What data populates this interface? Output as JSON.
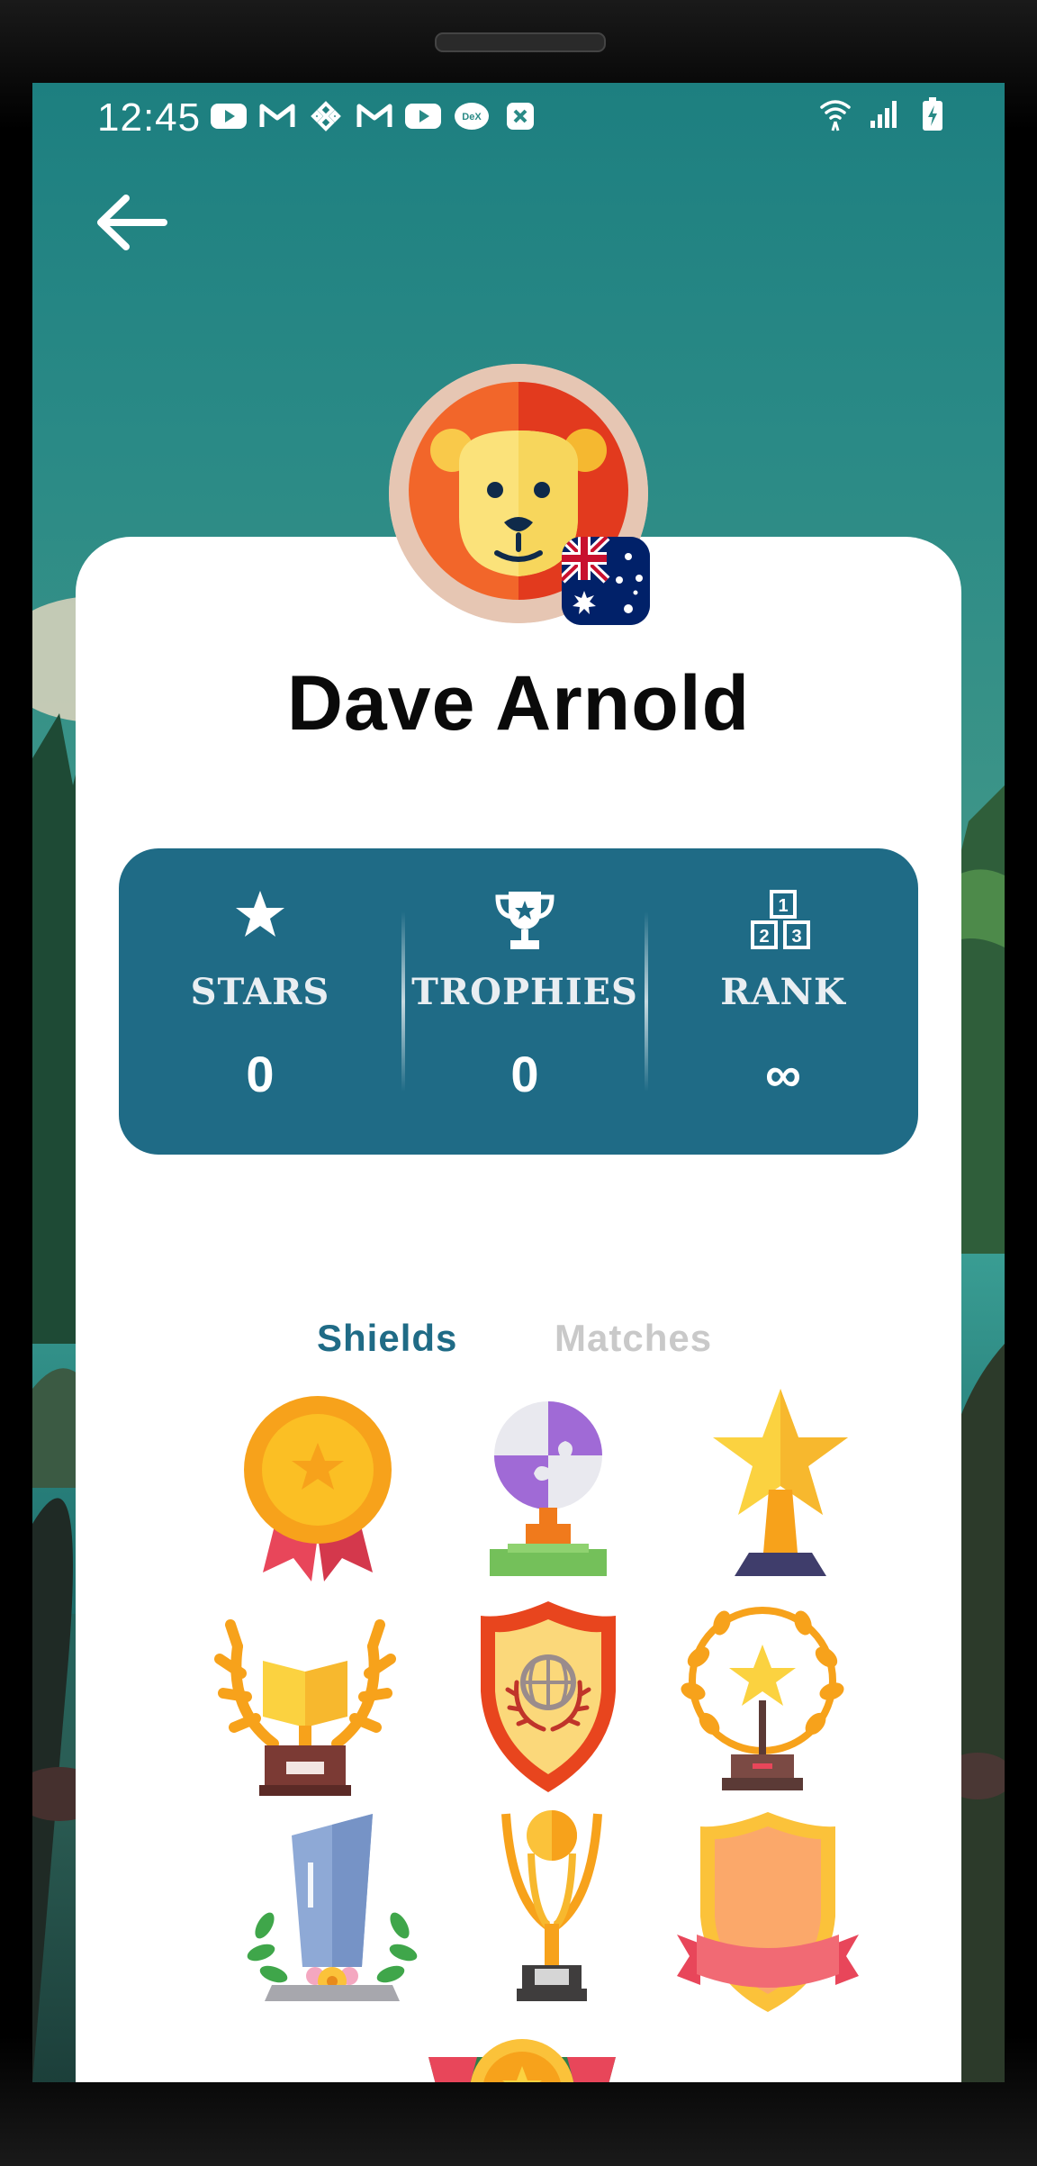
{
  "status_bar": {
    "time": "12:45",
    "notification_icons": [
      "youtube-icon",
      "gmail-icon",
      "binance-icon",
      "gmail-icon",
      "youtube-icon",
      "dex-icon",
      "close-box-icon"
    ],
    "system_icons": [
      "wifi-icon",
      "signal-icon",
      "battery-charging-icon"
    ]
  },
  "profile": {
    "name": "Dave Arnold",
    "avatar": "lion-avatar",
    "country_flag": "australia-flag"
  },
  "stats": [
    {
      "label": "STARS",
      "value": "0",
      "icon": "star-icon"
    },
    {
      "label": "TROPHIES",
      "value": "0",
      "icon": "trophy-icon"
    },
    {
      "label": "RANK",
      "value": "∞",
      "icon": "rank-blocks-icon"
    }
  ],
  "stats_icon_texts": {
    "rank_1": "1",
    "rank_2": "2",
    "rank_3": "3"
  },
  "tabs": {
    "shields": "Shields",
    "matches": "Matches",
    "active": "Shields"
  },
  "shields": [
    {
      "icon": "gold-medal-icon"
    },
    {
      "icon": "puzzle-globe-trophy-icon"
    },
    {
      "icon": "star-trophy-icon"
    },
    {
      "icon": "book-laurel-trophy-icon"
    },
    {
      "icon": "globe-shield-icon"
    },
    {
      "icon": "laurel-star-award-icon"
    },
    {
      "icon": "crystal-award-icon"
    },
    {
      "icon": "golden-ball-trophy-icon"
    },
    {
      "icon": "ribbon-shield-icon"
    },
    {
      "icon": "partial-badge-icon"
    }
  ],
  "colors": {
    "accent": "#1f6b86",
    "inactive_tab": "#c9c9c9",
    "card_bg": "#ffffff"
  }
}
